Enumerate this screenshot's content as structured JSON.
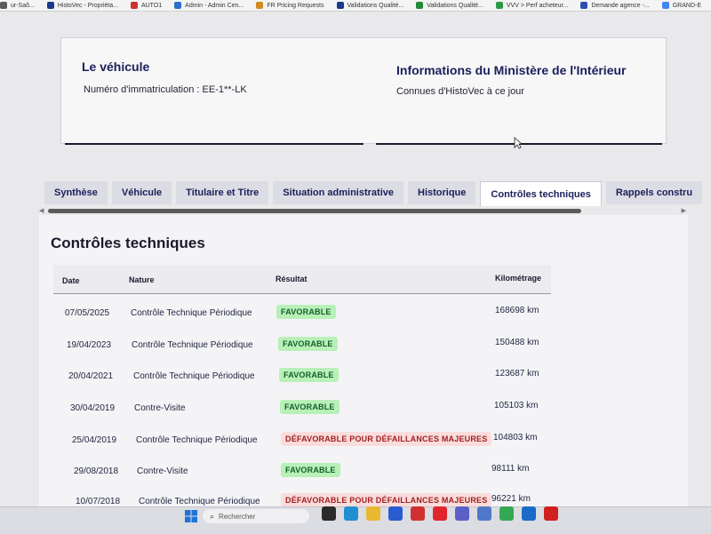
{
  "bookmarks": [
    {
      "label": "ur-Saô...",
      "color": "#5a5a5a"
    },
    {
      "label": "HistoVec - Propriéta...",
      "color": "#1a3a8a"
    },
    {
      "label": "AUTO1",
      "color": "#d03030"
    },
    {
      "label": "Admin - Admin Cen...",
      "color": "#2f6fd0"
    },
    {
      "label": "FR Pricing Requests",
      "color": "#d08a20"
    },
    {
      "label": "Validations Qualité...",
      "color": "#1a3a8a"
    },
    {
      "label": "Validations Qualité...",
      "color": "#1f8a3a"
    },
    {
      "label": "VVV > Perf acheteur...",
      "color": "#2a9a4a"
    },
    {
      "label": "Demande agence -...",
      "color": "#2f4fb0"
    },
    {
      "label": "GRAND-E",
      "color": "#4285f4"
    }
  ],
  "vehicle": {
    "title": "Le véhicule",
    "plate": "Numéro d'immatriculation : EE-1**-LK"
  },
  "ministry": {
    "title": "Informations du Ministère de l'Intérieur",
    "subtitle": "Connues d'HistoVec à ce jour"
  },
  "tabs": [
    "Synthèse",
    "Véhicule",
    "Titulaire et Titre",
    "Situation administrative",
    "Historique",
    "Contrôles techniques",
    "Rappels constru"
  ],
  "active_tab": "Contrôles techniques",
  "section": {
    "title": "Contrôles techniques",
    "headers": {
      "date": "Date",
      "nature": "Nature",
      "result": "Résultat",
      "km": "Kilométrage"
    },
    "rows": [
      {
        "date": "07/05/2025",
        "nature": "Contrôle Technique Périodique",
        "result": "FAVORABLE",
        "status": "ok",
        "km": "168698 km"
      },
      {
        "date": "19/04/2023",
        "nature": "Contrôle Technique Périodique",
        "result": "FAVORABLE",
        "status": "ok",
        "km": "150488 km"
      },
      {
        "date": "20/04/2021",
        "nature": "Contrôle Technique Périodique",
        "result": "FAVORABLE",
        "status": "ok",
        "km": "123687 km"
      },
      {
        "date": "30/04/2019",
        "nature": "Contre-Visite",
        "result": "FAVORABLE",
        "status": "ok",
        "km": "105103 km"
      },
      {
        "date": "25/04/2019",
        "nature": "Contrôle Technique Périodique",
        "result": "DÉFAVORABLE POUR DÉFAILLANCES MAJEURES",
        "status": "ko",
        "km": "104803 km"
      },
      {
        "date": "29/08/2018",
        "nature": "Contre-Visite",
        "result": "FAVORABLE",
        "status": "ok",
        "km": "98111 km"
      },
      {
        "date": "10/07/2018",
        "nature": "Contrôle Technique Périodique",
        "result": "DÉFAVORABLE POUR DÉFAILLANCES MAJEURES",
        "status": "ko",
        "km": "96221 km"
      }
    ]
  },
  "taskbar": {
    "search_placeholder": "Rechercher",
    "apps": [
      {
        "name": "task-view-icon",
        "color": "#2b2b2b"
      },
      {
        "name": "edge-icon",
        "color": "#1f8fd0"
      },
      {
        "name": "file-explorer-icon",
        "color": "#e8b830"
      },
      {
        "name": "store-icon",
        "color": "#2a5bd0"
      },
      {
        "name": "app-icon",
        "color": "#d03030"
      },
      {
        "name": "opera-icon",
        "color": "#e0262c"
      },
      {
        "name": "teams-icon",
        "color": "#5b5fc7"
      },
      {
        "name": "notepad-icon",
        "color": "#4f79c8"
      },
      {
        "name": "chrome-icon",
        "color": "#34a853"
      },
      {
        "name": "remote-icon",
        "color": "#1a6ac8"
      },
      {
        "name": "pdf-icon",
        "color": "#d02020"
      }
    ]
  }
}
